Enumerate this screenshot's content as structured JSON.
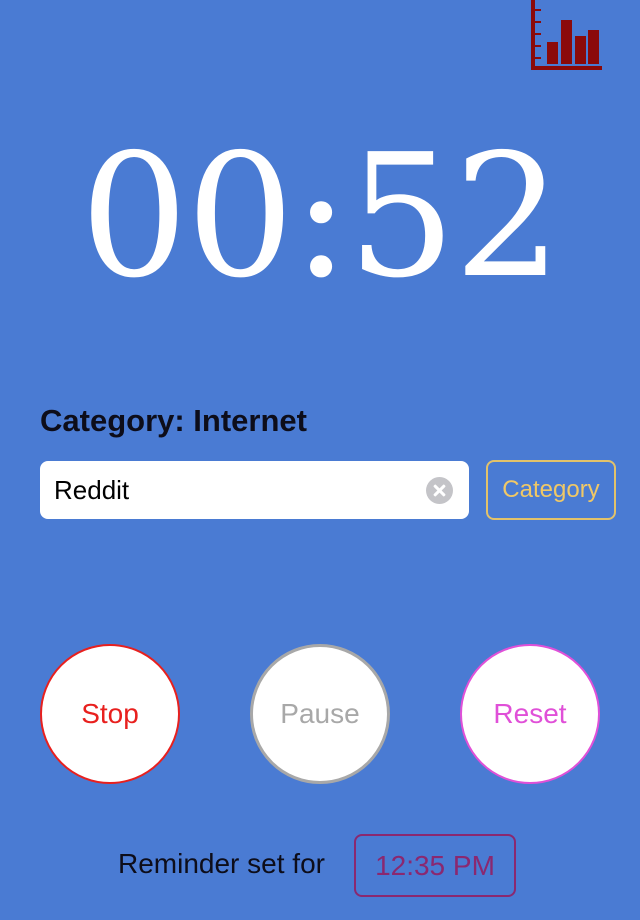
{
  "toolbar": {
    "stats_icon": "bar-chart-icon",
    "stats_color": "#8b0a0a"
  },
  "timer": {
    "display": "00:52"
  },
  "category": {
    "label": "Category: Internet",
    "activity_value": "Reddit",
    "button_label": "Category",
    "button_color": "#f0c866"
  },
  "controls": {
    "stop_label": "Stop",
    "stop_color": "#e8201e",
    "pause_label": "Pause",
    "pause_color": "#a8a8a8",
    "reset_label": "Reset",
    "reset_color": "#e050d8"
  },
  "reminder": {
    "label": "Reminder set for",
    "time": "12:35 PM",
    "time_color": "#8a2870"
  },
  "theme": {
    "background": "#4a7bd3"
  }
}
